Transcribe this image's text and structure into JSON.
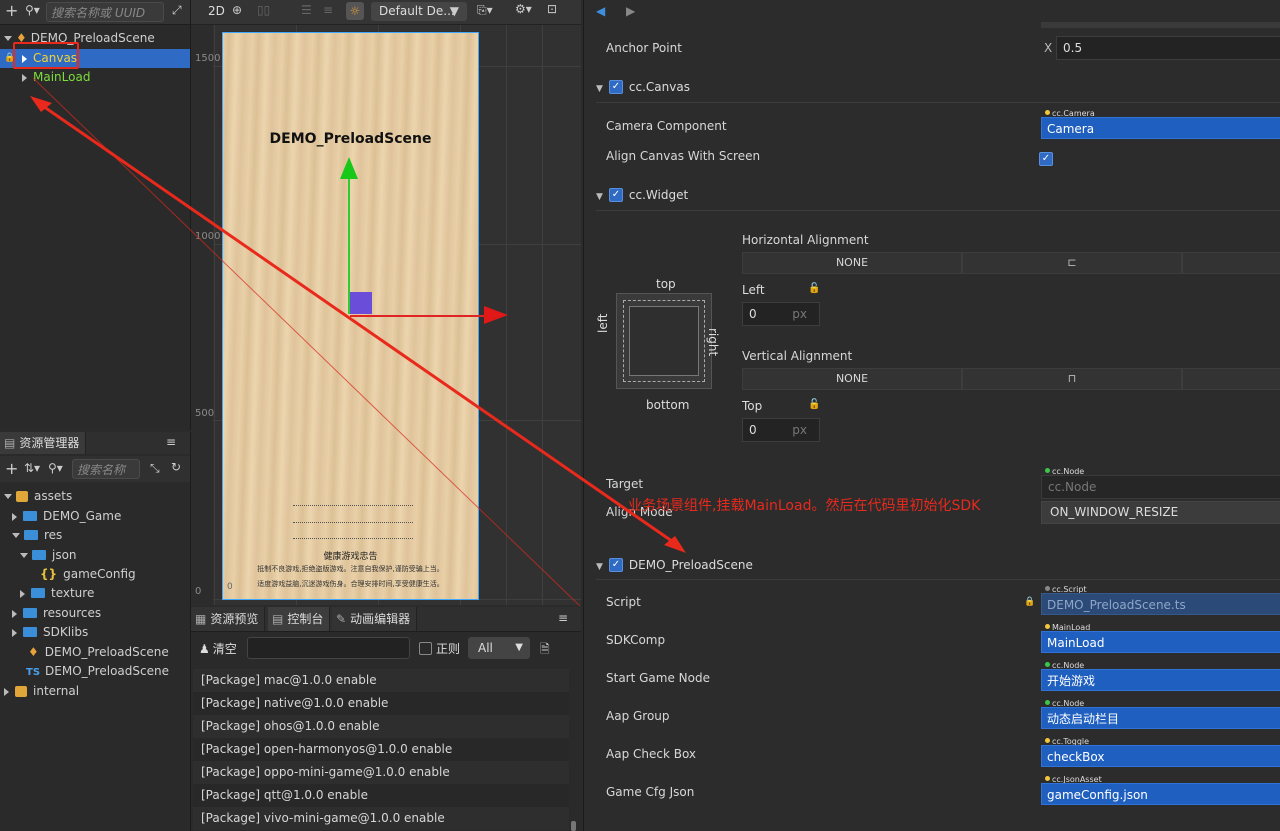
{
  "hierarchy": {
    "search_placeholder": "搜索名称或 UUID",
    "scene_name": "DEMO_PreloadScene",
    "nodes": [
      "Canvas",
      "MainLoad"
    ]
  },
  "assets": {
    "tab_label": "资源管理器",
    "search_placeholder": "搜索名称",
    "tree": [
      "assets",
      "DEMO_Game",
      "res",
      "json",
      "gameConfig",
      "texture",
      "resources",
      "SDKlibs",
      "DEMO_PreloadScene",
      "DEMO_PreloadScene",
      "internal"
    ],
    "ts_badge": "TS"
  },
  "scene_toolbar": {
    "mode": "2D",
    "camera_select": "Default De..."
  },
  "scene": {
    "ruler": [
      "1500",
      "1000",
      "500",
      "0"
    ],
    "canvas_title": "DEMO_PreloadScene",
    "notice_title": "健康游戏忠告",
    "notice_line1": "抵制不良游戏,拒绝盗版游戏。注意自我保护,谨防受骗上当。",
    "notice_line2": "适度游戏益脑,沉迷游戏伤身。合理安排时间,享受健康生活。",
    "corner_zero": "0"
  },
  "console": {
    "tabs": [
      "资源预览",
      "控制台",
      "动画编辑器"
    ],
    "clear_label": "清空",
    "regex_label": "正则",
    "level_select": "All",
    "logs": [
      "[Package] mac@1.0.0 enable",
      "[Package] native@1.0.0 enable",
      "[Package] ohos@1.0.0 enable",
      "[Package] open-harmonyos@1.0.0 enable",
      "[Package] oppo-mini-game@1.0.0 enable",
      "[Package] qtt@1.0.0 enable",
      "[Package] vivo-mini-game@1.0.0 enable"
    ]
  },
  "inspector": {
    "anchor_label": "Anchor Point",
    "anchor_axis": "X",
    "anchor_x": "0.5",
    "canvas_section": "cc.Canvas",
    "camera_component_label": "Camera Component",
    "camera_tag": "cc.Camera",
    "camera_value": "Camera",
    "align_canvas_label": "Align Canvas With Screen",
    "widget_section": "cc.Widget",
    "h_align_label": "Horizontal Alignment",
    "h_align_value": "NONE",
    "box_top": "top",
    "box_bottom": "bottom",
    "box_left": "left",
    "box_right": "right",
    "left_label": "Left",
    "left_value": "0",
    "unit_px": "px",
    "v_align_label": "Vertical Alignment",
    "v_align_value": "NONE",
    "top_label": "Top",
    "top_value": "0",
    "target_label": "Target",
    "target_tag": "cc.Node",
    "target_value": "cc.Node",
    "align_mode_label": "Align Mode",
    "align_mode_value": "ON_WINDOW_RESIZE",
    "script_section": "DEMO_PreloadScene",
    "script_label": "Script",
    "script_tag": "cc.Script",
    "script_value": "DEMO_PreloadScene.ts",
    "props": [
      {
        "label": "SDKComp",
        "tag": "MainLoad",
        "value": "MainLoad"
      },
      {
        "label": "Start Game Node",
        "tag": "cc.Node",
        "value": "开始游戏"
      },
      {
        "label": "Aap Group",
        "tag": "cc.Node",
        "value": "动态启动栏目"
      },
      {
        "label": "Aap Check Box",
        "tag": "cc.Toggle",
        "value": "checkBox"
      },
      {
        "label": "Game Cfg Json",
        "tag": "cc.JsonAsset",
        "value": "gameConfig.json"
      }
    ]
  },
  "annotation": {
    "text": "业务场景组件,挂载MainLoad。然后在代码里初始化SDK",
    "color": "#e8291c"
  }
}
